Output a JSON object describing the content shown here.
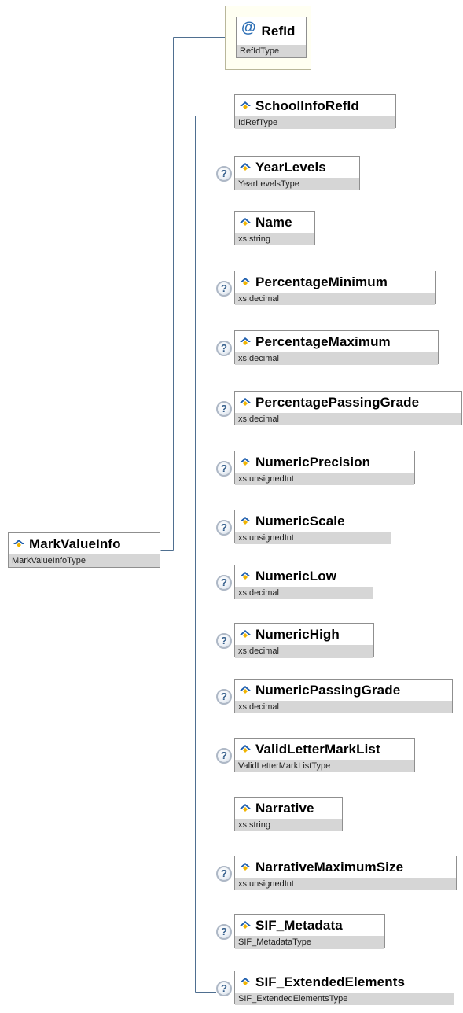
{
  "colors": {
    "connector": "#4f6f90",
    "type_bar": "#d6d6d6",
    "attribute_frame": "#b9b79a",
    "element_icon": "#1f5fae"
  },
  "root": {
    "name": "MarkValueInfo",
    "type": "MarkValueInfoType"
  },
  "attribute": {
    "icon": "at-icon",
    "symbol": "@",
    "name": "RefId",
    "type": "RefIdType"
  },
  "optional_icon": {
    "name": "question-icon",
    "symbol": "?"
  },
  "children": [
    {
      "name": "SchoolInfoRefId",
      "type": "IdRefType",
      "optional": false
    },
    {
      "name": "YearLevels",
      "type": "YearLevelsType",
      "optional": true
    },
    {
      "name": "Name",
      "type": "xs:string",
      "optional": false
    },
    {
      "name": "PercentageMinimum",
      "type": "xs:decimal",
      "optional": true
    },
    {
      "name": "PercentageMaximum",
      "type": "xs:decimal",
      "optional": true
    },
    {
      "name": "PercentagePassingGrade",
      "type": "xs:decimal",
      "optional": true
    },
    {
      "name": "NumericPrecision",
      "type": "xs:unsignedInt",
      "optional": true
    },
    {
      "name": "NumericScale",
      "type": "xs:unsignedInt",
      "optional": true
    },
    {
      "name": "NumericLow",
      "type": "xs:decimal",
      "optional": true
    },
    {
      "name": "NumericHigh",
      "type": "xs:decimal",
      "optional": true
    },
    {
      "name": "NumericPassingGrade",
      "type": "xs:decimal",
      "optional": true
    },
    {
      "name": "ValidLetterMarkList",
      "type": "ValidLetterMarkListType",
      "optional": true
    },
    {
      "name": "Narrative",
      "type": "xs:string",
      "optional": false
    },
    {
      "name": "NarrativeMaximumSize",
      "type": "xs:unsignedInt",
      "optional": true
    },
    {
      "name": "SIF_Metadata",
      "type": "SIF_MetadataType",
      "optional": true
    },
    {
      "name": "SIF_ExtendedElements",
      "type": "SIF_ExtendedElementsType",
      "optional": true
    }
  ]
}
